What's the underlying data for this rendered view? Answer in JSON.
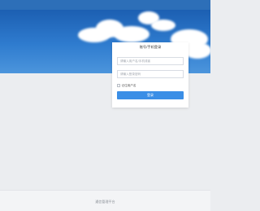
{
  "login": {
    "title": "账号/手机登录",
    "username_placeholder": "请输入用户名/手机或者",
    "password_placeholder": "请输入登录密码",
    "remember_label": "记住用户名",
    "submit_label": "登录"
  },
  "footer": {
    "text": "通信管理平台"
  },
  "colors": {
    "accent": "#3a8ee6",
    "banner_top": "#1c5fb2",
    "background": "#ebedf0"
  }
}
